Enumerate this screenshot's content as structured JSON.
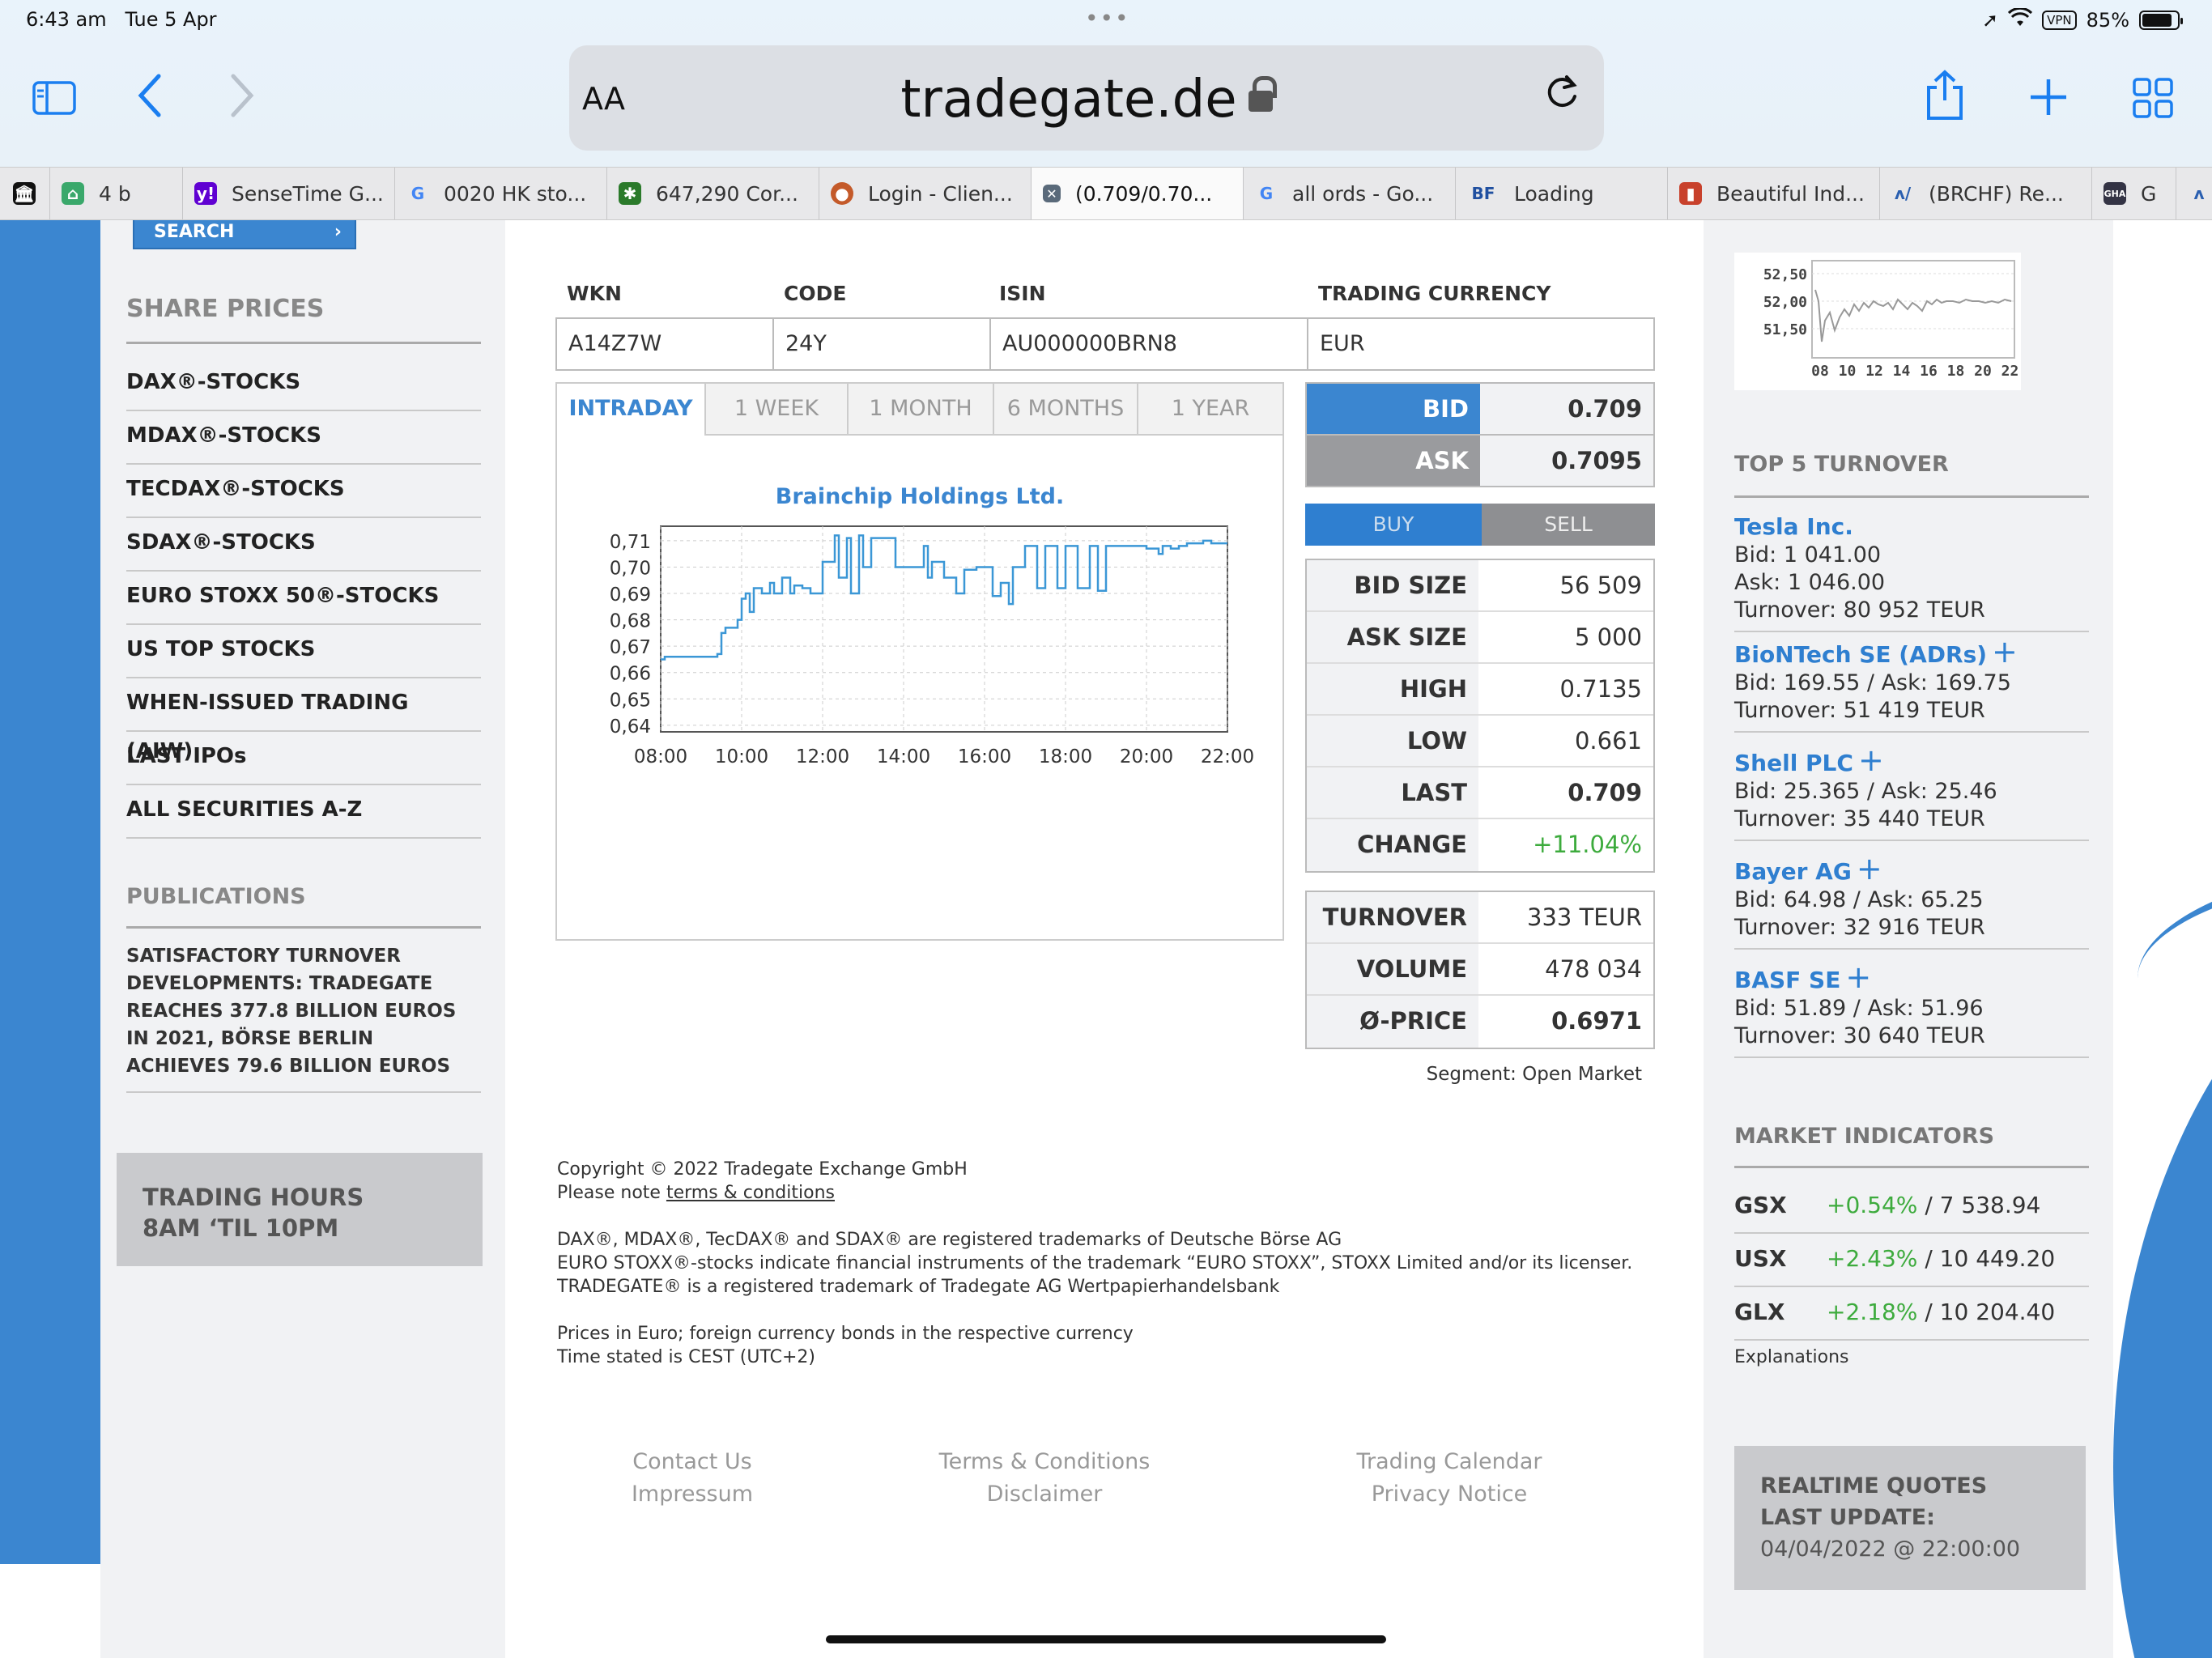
{
  "status_bar": {
    "time": "6:43 am",
    "date": "Tue 5 Apr",
    "vpn": "VPN",
    "battery": "85%",
    "battery_level": 0.85
  },
  "browser": {
    "text_size_label": "AA",
    "url": "tradegate.de",
    "tabs": [
      {
        "title": "4 b",
        "icon": "house-icon",
        "color": "#3aa86b"
      },
      {
        "title": "SenseTime G...",
        "icon": "yahoo-icon",
        "color": "#6001d2"
      },
      {
        "title": "0020 HK sto...",
        "icon": "google-icon",
        "color": "#4285f4"
      },
      {
        "title": "647,290 Cor...",
        "icon": "star-icon",
        "color": "#2b7a2b"
      },
      {
        "title": "Login - Clien...",
        "icon": "globe-icon",
        "color": "#c45a2a"
      },
      {
        "title": "(0.709/0.70...",
        "icon": "close-icon",
        "color": "#5a6a7a"
      },
      {
        "title": "all ords - Go...",
        "icon": "google-icon",
        "color": "#4285f4"
      },
      {
        "title": "Loading",
        "icon": "bf-icon",
        "color": "#1f4fa0"
      },
      {
        "title": "Beautiful Ind...",
        "icon": "bag-icon",
        "color": "#c8412c"
      },
      {
        "title": "(BRCHF) Re...",
        "icon": "chart-icon",
        "color": "#2a5fb0"
      },
      {
        "title": "G",
        "icon": "gha-icon",
        "color": "#333344"
      }
    ]
  },
  "left_sidebar": {
    "search_label": "SEARCH",
    "share_prices_heading": "SHARE PRICES",
    "share_items": [
      "DAX®-STOCKS",
      "MDAX®-STOCKS",
      "TECDAX®-STOCKS",
      "SDAX®-STOCKS",
      "EURO STOXX 50®-STOCKS",
      "US TOP STOCKS",
      "WHEN-ISSUED TRADING (AIW)",
      "LAST IPOs",
      "ALL SECURITIES A-Z"
    ],
    "publications_heading": "PUBLICATIONS",
    "publication_text": "SATISFACTORY TURNOVER DEVELOPMENTS: TRADEGATE REACHES 377.8 BILLION EUROS IN 2021, BÖRSE BERLIN ACHIEVES 79.6 BILLION EUROS",
    "trading_hours_line1": "TRADING HOURS",
    "trading_hours_line2": "8AM ‘TIL 10PM"
  },
  "security": {
    "headers": {
      "wkn": "WKN",
      "code": "CODE",
      "isin": "ISIN",
      "currency": "TRADING CURRENCY"
    },
    "wkn": "A14Z7W",
    "code": "24Y",
    "isin": "AU000000BRN8",
    "currency": "EUR"
  },
  "chart_tabs": [
    "INTRADAY",
    "1 WEEK",
    "1 MONTH",
    "6 MONTHS",
    "1 YEAR"
  ],
  "chart_data": {
    "type": "line",
    "title": "Brainchip Holdings Ltd.",
    "xlabel": "",
    "ylabel": "",
    "x_ticks": [
      "08:00",
      "10:00",
      "12:00",
      "14:00",
      "16:00",
      "18:00",
      "20:00",
      "22:00"
    ],
    "y_ticks": [
      "0,71",
      "0,70",
      "0,69",
      "0,68",
      "0,67",
      "0,66",
      "0,65",
      "0,64"
    ],
    "xlim": [
      8,
      22
    ],
    "ylim": [
      0.6375,
      0.7155
    ],
    "grid": true,
    "series": [
      {
        "x": [
          8.0,
          8.1,
          8.3,
          9.0,
          9.4,
          9.5,
          9.6,
          9.9,
          10.0,
          10.1,
          10.2,
          10.3,
          10.5,
          10.7,
          10.8,
          11.0,
          11.2,
          11.3,
          11.5,
          11.7,
          12.0,
          12.3,
          12.4,
          12.6,
          12.7,
          12.9,
          13.0,
          13.2,
          13.7,
          13.8,
          13.9,
          14.3,
          14.5,
          14.6,
          14.7,
          15.0,
          15.3,
          15.5,
          15.8,
          16.2,
          16.4,
          16.6,
          16.7,
          17.0,
          17.3,
          17.5,
          17.8,
          18.0,
          18.2,
          18.3,
          18.6,
          18.8,
          19.0,
          19.3,
          19.5,
          19.8,
          20.0,
          20.3,
          20.4,
          20.6,
          20.8,
          21.0,
          21.2,
          21.4,
          21.6,
          21.8,
          22.0
        ],
        "y": [
          0.665,
          0.666,
          0.666,
          0.666,
          0.667,
          0.675,
          0.677,
          0.68,
          0.688,
          0.69,
          0.683,
          0.692,
          0.69,
          0.694,
          0.69,
          0.696,
          0.69,
          0.693,
          0.692,
          0.69,
          0.702,
          0.712,
          0.696,
          0.711,
          0.69,
          0.712,
          0.7,
          0.711,
          0.711,
          0.7,
          0.7,
          0.7,
          0.708,
          0.696,
          0.702,
          0.696,
          0.69,
          0.699,
          0.7,
          0.689,
          0.694,
          0.686,
          0.7,
          0.708,
          0.692,
          0.708,
          0.692,
          0.708,
          0.708,
          0.692,
          0.708,
          0.691,
          0.708,
          0.708,
          0.708,
          0.708,
          0.707,
          0.705,
          0.708,
          0.707,
          0.708,
          0.709,
          0.709,
          0.71,
          0.709,
          0.709,
          0.709
        ]
      }
    ]
  },
  "quote": {
    "bid_label": "BID",
    "bid": "0.709",
    "ask_label": "ASK",
    "ask": "0.7095",
    "buy_label": "BUY",
    "sell_label": "SELL",
    "stats": [
      {
        "label": "BID SIZE",
        "value": "56 509"
      },
      {
        "label": "ASK SIZE",
        "value": "5 000"
      },
      {
        "label": "HIGH",
        "value": "0.7135"
      },
      {
        "label": "LOW",
        "value": "0.661"
      },
      {
        "label": "LAST",
        "value": "0.709"
      },
      {
        "label": "CHANGE",
        "value": "+11.04%"
      }
    ],
    "volume_stats": [
      {
        "label": "TURNOVER",
        "value": "333 TEUR"
      },
      {
        "label": "VOLUME",
        "value": "478 034"
      },
      {
        "label": "Ø-PRICE",
        "value": "0.6971"
      }
    ],
    "segment": "Segment: Open Market"
  },
  "footer": {
    "copyright": "Copyright © 2022 Tradegate Exchange GmbH",
    "note_prefix": "Please note ",
    "terms_link": "terms & conditions",
    "trademark1": "DAX®, MDAX®, TecDAX® and SDAX® are registered trademarks of Deutsche Börse AG",
    "trademark2": "EURO STOXX®-stocks indicate financial instruments of the trademark “EURO STOXX”, STOXX Limited and/or its licenser.",
    "trademark3": "TRADEGATE® is a registered trademark of Tradegate AG Wertpapierhandelsbank",
    "prices_note": "Prices in Euro; foreign currency bonds in the respective currency",
    "time_note": "Time stated is CEST (UTC+2)",
    "links": {
      "contact": "Contact Us",
      "impressum": "Impressum",
      "terms": "Terms & Conditions",
      "disclaimer": "Disclaimer",
      "calendar": "Trading Calendar",
      "privacy": "Privacy Notice"
    }
  },
  "right_sidebar": {
    "mini_chart": {
      "y_ticks": [
        "52,50",
        "52,00",
        "51,50"
      ],
      "x_ticks": [
        "08",
        "10",
        "12",
        "14",
        "16",
        "18",
        "20",
        "22"
      ]
    },
    "top5_heading": "TOP 5 TURNOVER",
    "top5": [
      {
        "name": "Tesla Inc.",
        "line1": "Bid: 1 041.00",
        "line2": "Ask: 1 046.00",
        "line3": "Turnover: 80 952 TEUR",
        "plus": false
      },
      {
        "name": "BioNTech SE (ADRs)",
        "line1": "Bid: 169.55 / Ask: 169.75",
        "line2": "Turnover: 51 419 TEUR",
        "plus": true
      },
      {
        "name": "Shell PLC",
        "line1": "Bid: 25.365 / Ask: 25.46",
        "line2": "Turnover: 35 440 TEUR",
        "plus": true
      },
      {
        "name": "Bayer AG",
        "line1": "Bid: 64.98 / Ask: 65.25",
        "line2": "Turnover: 32 916 TEUR",
        "plus": true
      },
      {
        "name": "BASF SE",
        "line1": "Bid: 51.89 / Ask: 51.96",
        "line2": "Turnover: 30 640 TEUR",
        "plus": true
      }
    ],
    "indicators_heading": "MARKET INDICATORS",
    "indicators": [
      {
        "name": "GSX",
        "change": "+0.54%",
        "value": "/ 7 538.94"
      },
      {
        "name": "USX",
        "change": "+2.43%",
        "value": "/ 10 449.20"
      },
      {
        "name": "GLX",
        "change": "+2.18%",
        "value": "/ 10 204.40"
      }
    ],
    "explanations": "Explanations",
    "realtime_line1": "REALTIME QUOTES",
    "realtime_line2": "LAST UPDATE:",
    "realtime_line3": "04/04/2022 @ 22:00:00"
  }
}
